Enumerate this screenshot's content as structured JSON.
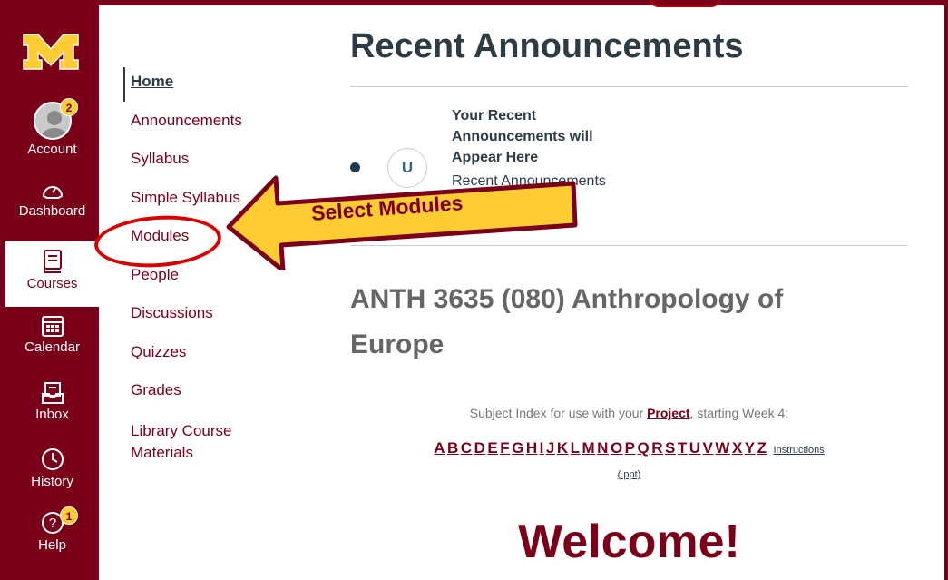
{
  "global_nav": {
    "logo_text": "M",
    "items": [
      {
        "label": "Account",
        "badge": "2"
      },
      {
        "label": "Dashboard"
      },
      {
        "label": "Courses"
      },
      {
        "label": "Calendar"
      },
      {
        "label": "Inbox"
      },
      {
        "label": "History"
      },
      {
        "label": "Help",
        "badge": "1"
      }
    ]
  },
  "course_nav": {
    "items": [
      "Home",
      "Announcements",
      "Syllabus",
      "Simple Syllabus",
      "Modules",
      "People",
      "Discussions",
      "Quizzes",
      "Grades",
      "Library Course Materials"
    ]
  },
  "main": {
    "title": "Recent Announcements",
    "announcement": {
      "avatar_letter": "U",
      "title": "Your Recent Announcements will Appear Here",
      "subtitle": "Recent Announcements"
    },
    "course_title": "ANTH 3635 (080) Anthropology of Europe",
    "subject_prefix": "Subject Index for use with your ",
    "subject_link": "Project",
    "subject_suffix": ", starting Week 4:",
    "alphabet": [
      "A",
      "B",
      "C",
      "D",
      "E",
      "F",
      "G",
      "H",
      "I",
      "J",
      "K",
      "L",
      "M",
      "N",
      "O",
      "P",
      "Q",
      "R",
      "S",
      "T",
      "U",
      "V",
      "W",
      "X",
      "Y",
      "Z"
    ],
    "instructions": "Instructions",
    "ppt": "(.ppt)",
    "welcome": "Welcome!"
  },
  "annotation": {
    "callout": "Select Modules"
  },
  "colors": {
    "maroon": "#7a0019",
    "gold": "#ffcc33",
    "callout_red": "#d60000"
  }
}
